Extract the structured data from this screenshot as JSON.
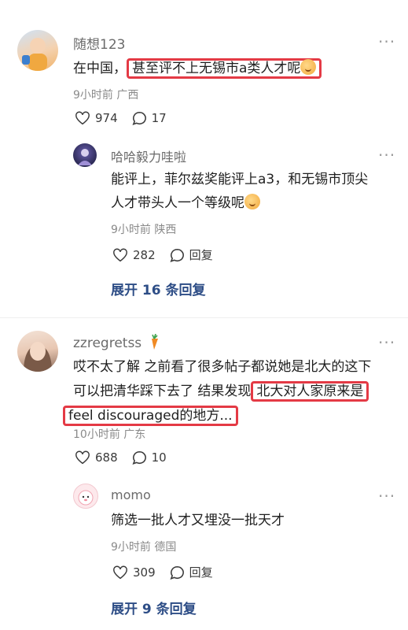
{
  "comments": [
    {
      "username": "随想123",
      "text_plain": "在中国，",
      "text_highlight": "甚至评不上无锡市a类人才呢",
      "meta": "9小时前 广西",
      "likes": "974",
      "replies": "17",
      "sub": {
        "username": "哈哈毅力哇啦",
        "line1": "能评上，菲尔兹奖能评上a3，和无锡市顶尖",
        "line2": "人才带头人一个等级呢",
        "meta": "9小时前 陕西",
        "likes": "282",
        "reply_label": "回复"
      },
      "expand": "展开 16 条回复"
    },
    {
      "username": "zzregretss",
      "line1": "哎不太了解 之前看了很多帖子都说她是北大的这下",
      "line2_plain": "可以把清华踩下去了 结果发现",
      "line2_highlight": "北大对人家原来是",
      "line3_highlight": "feel discouraged的地方...",
      "meta": "10小时前 广东",
      "likes": "688",
      "replies": "10",
      "sub": {
        "username": "momo",
        "line1": "筛选一批人才又埋没一批天才",
        "meta": "9小时前 德国",
        "likes": "309",
        "reply_label": "回复"
      },
      "expand": "展开 9 条回复"
    }
  ],
  "more_glyph": "···",
  "colors": {
    "highlight_border": "#e43a45",
    "expand_link": "#2d4d86"
  }
}
